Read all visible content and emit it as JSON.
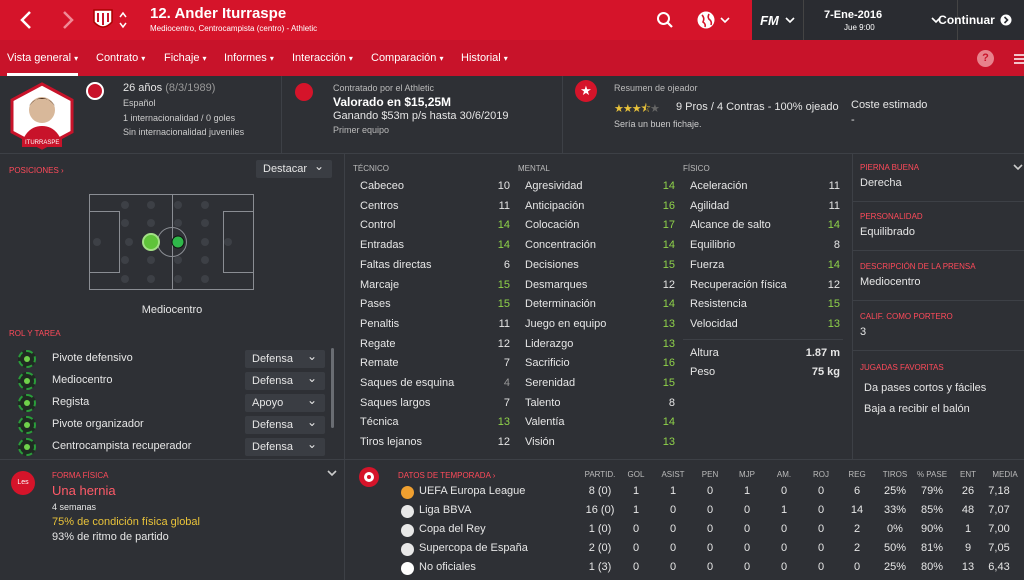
{
  "header": {
    "player_name": "12. Ander Iturraspe",
    "player_sub": "Mediocentro, Centrocampista (centro) - Athletic",
    "date": "7-Ene-2016",
    "time": "Jue 9:00",
    "continue_label": "Continuar",
    "fm_label": "FM"
  },
  "tabs": [
    "Vista general",
    "Contrato",
    "Fichaje",
    "Informes",
    "Interacción",
    "Comparación",
    "Historial"
  ],
  "profile": {
    "age": "26 años",
    "dob": "(8/3/1989)",
    "nationality": "Español",
    "caps": "1 internacionalidad / 0 goles",
    "youth": "Sin internacionalidad juveniles",
    "badge_name": "ITURRASPE"
  },
  "contract": {
    "club_line": "Contratado por el Athletic",
    "value": "Valorado en $15,25M",
    "wage": "Ganando $53m p/s hasta 30/6/2019",
    "status": "Primer equipo"
  },
  "scout": {
    "title": "Resumen de ojeador",
    "summary": "9 Pros / 4 Contras - 100% ojeado",
    "verdict": "Sería un buen fichaje.",
    "rating": 3.5,
    "cost_label": "Coste estimado",
    "cost_value": "-"
  },
  "positions": {
    "title": "POSICIONES",
    "highlight_label": "Destacar",
    "position_label": "Mediocentro"
  },
  "roles": {
    "title": "ROL Y TAREA",
    "items": [
      {
        "role": "Pivote defensivo",
        "duty": "Defensa"
      },
      {
        "role": "Mediocentro",
        "duty": "Defensa"
      },
      {
        "role": "Regista",
        "duty": "Apoyo"
      },
      {
        "role": "Pivote organizador",
        "duty": "Defensa"
      },
      {
        "role": "Centrocampista recuperador",
        "duty": "Defensa"
      }
    ]
  },
  "attributes": {
    "technical_title": "TÉCNICO",
    "mental_title": "MENTAL",
    "physical_title": "FÍSICO",
    "technical": [
      {
        "name": "Cabeceo",
        "value": "10"
      },
      {
        "name": "Centros",
        "value": "11"
      },
      {
        "name": "Control",
        "value": "14"
      },
      {
        "name": "Entradas",
        "value": "14"
      },
      {
        "name": "Faltas directas",
        "value": "6"
      },
      {
        "name": "Marcaje",
        "value": "15"
      },
      {
        "name": "Pases",
        "value": "15"
      },
      {
        "name": "Penaltis",
        "value": "11"
      },
      {
        "name": "Regate",
        "value": "12"
      },
      {
        "name": "Remate",
        "value": "7"
      },
      {
        "name": "Saques de esquina",
        "value": "4"
      },
      {
        "name": "Saques largos",
        "value": "7"
      },
      {
        "name": "Técnica",
        "value": "13"
      },
      {
        "name": "Tiros lejanos",
        "value": "12"
      }
    ],
    "mental": [
      {
        "name": "Agresividad",
        "value": "14"
      },
      {
        "name": "Anticipación",
        "value": "16"
      },
      {
        "name": "Colocación",
        "value": "17"
      },
      {
        "name": "Concentración",
        "value": "14"
      },
      {
        "name": "Decisiones",
        "value": "15"
      },
      {
        "name": "Desmarques",
        "value": "12"
      },
      {
        "name": "Determinación",
        "value": "14"
      },
      {
        "name": "Juego en equipo",
        "value": "13"
      },
      {
        "name": "Liderazgo",
        "value": "13"
      },
      {
        "name": "Sacrificio",
        "value": "16"
      },
      {
        "name": "Serenidad",
        "value": "15"
      },
      {
        "name": "Talento",
        "value": "8"
      },
      {
        "name": "Valentía",
        "value": "14"
      },
      {
        "name": "Visión",
        "value": "13"
      }
    ],
    "physical": [
      {
        "name": "Aceleración",
        "value": "11"
      },
      {
        "name": "Agilidad",
        "value": "11"
      },
      {
        "name": "Alcance de salto",
        "value": "14"
      },
      {
        "name": "Equilibrio",
        "value": "8"
      },
      {
        "name": "Fuerza",
        "value": "14"
      },
      {
        "name": "Recuperación física",
        "value": "12"
      },
      {
        "name": "Resistencia",
        "value": "15"
      },
      {
        "name": "Velocidad",
        "value": "13"
      }
    ],
    "height_label": "Altura",
    "height_value": "1.87 m",
    "weight_label": "Peso",
    "weight_value": "75 kg"
  },
  "side": {
    "foot_title": "PIERNA BUENA",
    "foot_value": "Derecha",
    "personality_title": "PERSONALIDAD",
    "personality_value": "Equilibrado",
    "press_title": "DESCRIPCIÓN DE LA PRENSA",
    "press_value": "Mediocentro",
    "gk_title": "CALIF. COMO PORTERO",
    "gk_value": "3",
    "moves_title": "JUGADAS FAVORITAS",
    "moves": [
      "Da pases cortos y fáciles",
      "Baja a recibir el balón"
    ]
  },
  "fitness": {
    "title": "FORMA FÍSICA",
    "badge": "Les",
    "injury": "Una hernia",
    "duration": "4 semanas",
    "condition": "75% de condición física global",
    "sharpness": "93% de ritmo de partido"
  },
  "season": {
    "title": "DATOS DE TEMPORADA",
    "columns": [
      "PARTID.",
      "GOL",
      "ASIST",
      "PEN",
      "MJP",
      "AM.",
      "ROJ",
      "REG",
      "TIROS",
      "% PASE",
      "ENT",
      "MEDIA"
    ],
    "rows": [
      {
        "comp": "UEFA Europa League",
        "cells": [
          "8 (0)",
          "1",
          "1",
          "0",
          "1",
          "0",
          "0",
          "6",
          "25%",
          "79%",
          "26",
          "7,18"
        ]
      },
      {
        "comp": "Liga BBVA",
        "cells": [
          "16 (0)",
          "1",
          "0",
          "0",
          "0",
          "1",
          "0",
          "14",
          "33%",
          "85%",
          "48",
          "7,07"
        ]
      },
      {
        "comp": "Copa del Rey",
        "cells": [
          "1 (0)",
          "0",
          "0",
          "0",
          "0",
          "0",
          "0",
          "2",
          "0%",
          "90%",
          "1",
          "7,00"
        ]
      },
      {
        "comp": "Supercopa de España",
        "cells": [
          "2 (0)",
          "0",
          "0",
          "0",
          "0",
          "0",
          "0",
          "2",
          "50%",
          "81%",
          "9",
          "7,05"
        ]
      },
      {
        "comp": "No oficiales",
        "cells": [
          "1 (3)",
          "0",
          "0",
          "0",
          "0",
          "0",
          "0",
          "0",
          "25%",
          "80%",
          "13",
          "6,43"
        ]
      }
    ]
  },
  "colors": {
    "accent": "#d5142a",
    "good": "#8fd24a",
    "bg": "#2e3035"
  }
}
